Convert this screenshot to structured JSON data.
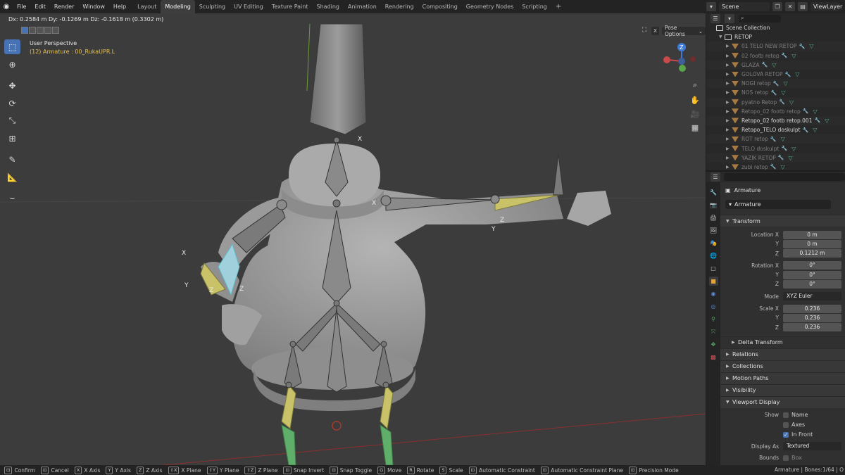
{
  "menu": [
    "File",
    "Edit",
    "Render",
    "Window",
    "Help"
  ],
  "workspaces": [
    "Layout",
    "Modeling",
    "Sculpting",
    "UV Editing",
    "Texture Paint",
    "Shading",
    "Animation",
    "Rendering",
    "Compositing",
    "Geometry Nodes",
    "Scripting"
  ],
  "active_workspace": "Modeling",
  "scene_name": "Scene",
  "view_layer": "ViewLayer",
  "viewport": {
    "status_line": "Dx: 0.2584 m   Dy: -0.1269 m   Dz: -0.1618 m (0.3302 m)",
    "perspective_title": "User Perspective",
    "perspective_sub": "(12) Armature : 00_RukaUPR.L",
    "pose_options": "Pose Options",
    "x_mirror": "X"
  },
  "outliner": {
    "root": "Scene Collection",
    "main": "RETOP",
    "items": [
      {
        "label": "01 TELO NEW RETOP",
        "dim": true
      },
      {
        "label": "02 footb retop",
        "dim": true
      },
      {
        "label": "GLAZA",
        "dim": true
      },
      {
        "label": "GOLOVA RETOP",
        "dim": true
      },
      {
        "label": "NOGI retop",
        "dim": true
      },
      {
        "label": "NOS retop",
        "dim": true
      },
      {
        "label": "pyatno Retop",
        "dim": true
      },
      {
        "label": "Retopo_02 footb retop",
        "dim": true
      },
      {
        "label": "Retopo_02 footb retop.001",
        "dim": false
      },
      {
        "label": "Retopo_TELO doskulpt",
        "dim": false
      },
      {
        "label": "ROT retop",
        "dim": true
      },
      {
        "label": "TELO doskulpt",
        "dim": true
      },
      {
        "label": "YAZIK RETOP",
        "dim": true
      },
      {
        "label": "zubi retop",
        "dim": true
      }
    ]
  },
  "properties": {
    "context_name": "Armature",
    "object_name": "Armature",
    "transform_header": "Transform",
    "location_label": "Location X",
    "location": [
      "0 m",
      "0 m",
      "0.1212 m"
    ],
    "rotation_label": "Rotation X",
    "rotation": [
      "0°",
      "0°",
      "0°"
    ],
    "mode_label": "Mode",
    "mode_value": "XYZ Euler",
    "scale_label": "Scale X",
    "scale": [
      "0.236",
      "0.236",
      "0.236"
    ],
    "axis_y": "Y",
    "axis_z": "Z",
    "delta_transform": "Delta Transform",
    "relations": "Relations",
    "collections": "Collections",
    "motion_paths": "Motion Paths",
    "visibility": "Visibility",
    "viewport_display": "Viewport Display",
    "show_label": "Show",
    "show_name": "Name",
    "show_axes": "Axes",
    "in_front": "In Front",
    "display_as_label": "Display As",
    "display_as_value": "Textured",
    "bounds_label": "Bounds",
    "bounds_value": "Box"
  },
  "statusbar": {
    "hints": [
      {
        "key": "⊡",
        "label": "Confirm"
      },
      {
        "key": "⊡",
        "label": "Cancel"
      },
      {
        "key": "X",
        "label": "X Axis"
      },
      {
        "key": "Y",
        "label": "Y Axis"
      },
      {
        "key": "Z",
        "label": "Z Axis"
      },
      {
        "key": "⇧X",
        "label": "X Plane"
      },
      {
        "key": "⇧Y",
        "label": "Y Plane"
      },
      {
        "key": "⇧Z",
        "label": "Z Plane"
      },
      {
        "key": "⊡",
        "label": "Snap Invert"
      },
      {
        "key": "⊡",
        "label": "Snap Toggle"
      },
      {
        "key": "G",
        "label": "Move"
      },
      {
        "key": "R",
        "label": "Rotate"
      },
      {
        "key": "S",
        "label": "Scale"
      },
      {
        "key": "⊡",
        "label": "Automatic Constraint"
      },
      {
        "key": "⊡",
        "label": "Automatic Constraint Plane"
      },
      {
        "key": "⊡",
        "label": "Precision Mode"
      }
    ],
    "stats": "Armature | Bones:1/64 | O"
  },
  "colors": {
    "accent": "#4772b3",
    "viewport_bg": "#3c3c3c",
    "bone_selected": "#c9c268",
    "bone_green": "#5fae6a",
    "bone_cyan": "#7ec7d8",
    "axis_red": "#a13b3b"
  }
}
